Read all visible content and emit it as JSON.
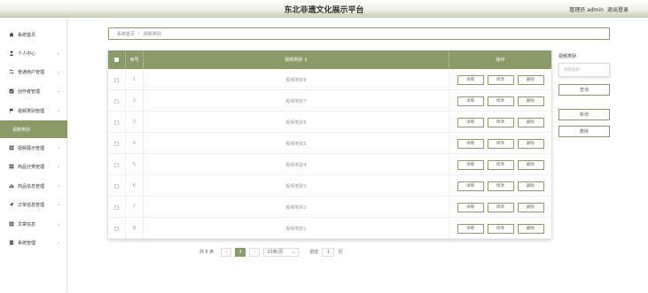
{
  "header": {
    "title": "东北非遗文化展示平台",
    "user": "管理员 admin",
    "logout": "退出登录"
  },
  "sidebar": {
    "items": [
      {
        "label": "系统首页",
        "icon": "home-icon",
        "chevron": ""
      },
      {
        "label": "个人中心",
        "icon": "user-icon",
        "chevron": "⌄"
      },
      {
        "label": "普通用户管理",
        "icon": "sliders-icon",
        "chevron": "⌄"
      },
      {
        "label": "创作者管理",
        "icon": "checkbox-icon",
        "chevron": "⌄"
      },
      {
        "label": "视频类别管理",
        "icon": "flag-icon",
        "chevron": "⌄"
      },
      {
        "label": "视频类别",
        "icon": "",
        "chevron": ""
      },
      {
        "label": "视频展示管理",
        "icon": "grid-icon",
        "chevron": "⌄"
      },
      {
        "label": "商品分类管理",
        "icon": "grid-icon",
        "chevron": "⌄"
      },
      {
        "label": "商品信息管理",
        "icon": "bar-chart-icon",
        "chevron": "⌄"
      },
      {
        "label": "订单信息管理",
        "icon": "send-icon",
        "chevron": "⌄"
      },
      {
        "label": "文章信息",
        "icon": "grid-icon",
        "chevron": "⌄"
      },
      {
        "label": "系统管理",
        "icon": "database-icon",
        "chevron": "⌄"
      }
    ],
    "active_index": 5
  },
  "breadcrumb": {
    "home": "系统首页",
    "separator": "/",
    "current": "视频类别"
  },
  "table": {
    "headers": {
      "index": "序号",
      "category": "视频类别 ⇕",
      "actions": "操作"
    },
    "rows": [
      {
        "index": "1",
        "category": "视频类别8"
      },
      {
        "index": "2",
        "category": "视频类别7"
      },
      {
        "index": "3",
        "category": "视频类别6"
      },
      {
        "index": "4",
        "category": "视频类别5"
      },
      {
        "index": "5",
        "category": "视频类别4"
      },
      {
        "index": "6",
        "category": "视频类别3"
      },
      {
        "index": "7",
        "category": "视频类别2"
      },
      {
        "index": "8",
        "category": "视频类别1"
      }
    ],
    "actions": {
      "detail": "详情",
      "edit": "修改",
      "delete": "删除"
    }
  },
  "pagination": {
    "total": "共 8 条",
    "prev": "‹",
    "current": "1",
    "next": "›",
    "page_size": "10条/页",
    "page_size_arrow": "⌄",
    "goto_label": "前往",
    "goto_value": "1",
    "goto_suffix": "页"
  },
  "side_panel": {
    "label": "视频类别",
    "input_placeholder": "视频类别",
    "search": "查询",
    "add": "新增",
    "delete": "删除"
  },
  "colors": {
    "accent": "#8a9a68"
  }
}
